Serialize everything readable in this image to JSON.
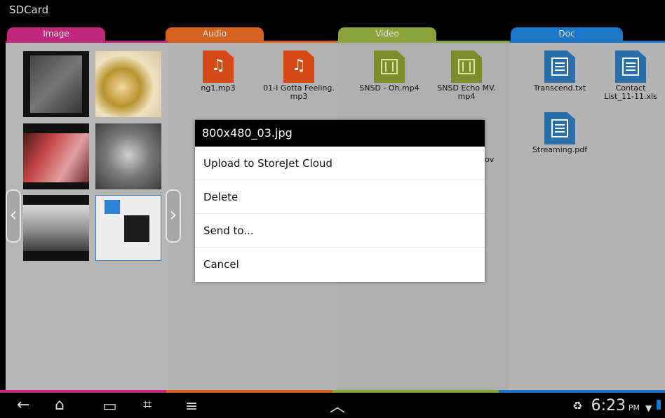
{
  "title": "SDCard",
  "tabs": [
    {
      "label": "Image",
      "color": "#c0287a"
    },
    {
      "label": "Audio",
      "color": "#d5621f"
    },
    {
      "label": "Video",
      "color": "#8aa33a"
    },
    {
      "label": "Doc",
      "color": "#1c77c9"
    }
  ],
  "audio_files": [
    {
      "name": "ng1.mp3"
    },
    {
      "name": "01-I Gotta Feeling.\nmp3"
    }
  ],
  "video_files": [
    {
      "name": "SNSD - Oh.mp4"
    },
    {
      "name": "SNSD Echo MV.\nmp4"
    },
    {
      "name": "ov"
    }
  ],
  "doc_files": [
    {
      "name": "Transcend.txt"
    },
    {
      "name": "Contact\nList_11-11.xls"
    },
    {
      "name": "Streaming.pdf"
    }
  ],
  "dialog": {
    "title": "800x480_03.jpg",
    "items": [
      "Upload to StoreJet Cloud",
      "Delete",
      "Send to...",
      "Cancel"
    ]
  },
  "status": {
    "time": "6:23",
    "ampm": "PM"
  },
  "icons": {
    "back": "back-icon",
    "home": "home-icon",
    "recent": "recent-apps-icon",
    "screenshot": "screenshot-icon",
    "menu": "menu-icon",
    "up": "chevron-up-icon",
    "recycle": "recycle-icon",
    "wifi": "wifi-icon",
    "battery": "battery-icon"
  }
}
